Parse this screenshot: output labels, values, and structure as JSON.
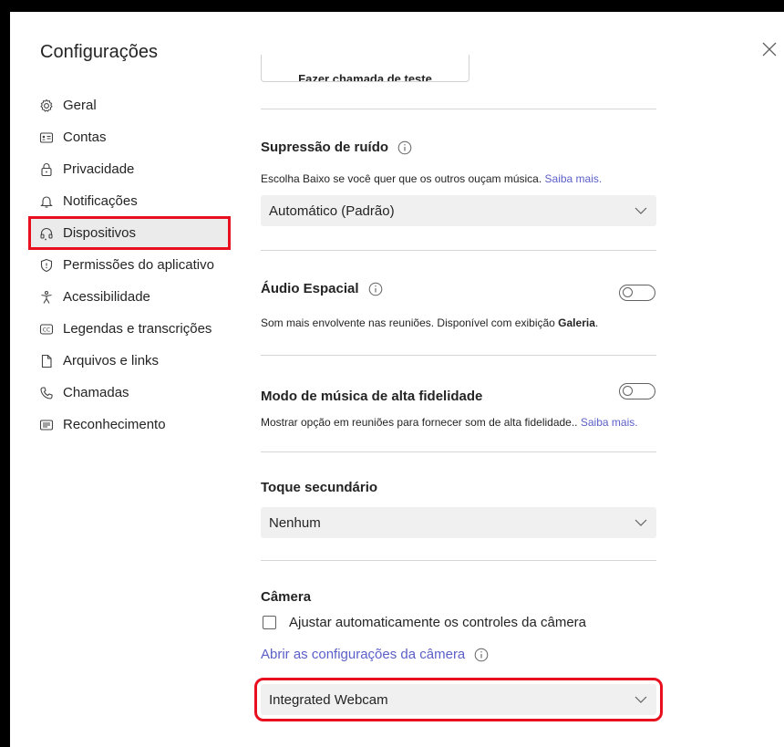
{
  "window": {
    "title": "Configurações"
  },
  "sidebar": {
    "items": [
      {
        "label": "Geral",
        "icon": "gear-icon"
      },
      {
        "label": "Contas",
        "icon": "account-card-icon"
      },
      {
        "label": "Privacidade",
        "icon": "lock-icon"
      },
      {
        "label": "Notificações",
        "icon": "bell-icon"
      },
      {
        "label": "Dispositivos",
        "icon": "headset-icon",
        "active": true
      },
      {
        "label": "Permissões do aplicativo",
        "icon": "shield-icon"
      },
      {
        "label": "Acessibilidade",
        "icon": "accessibility-icon"
      },
      {
        "label": "Legendas e transcrições",
        "icon": "cc-icon"
      },
      {
        "label": "Arquivos e links",
        "icon": "file-icon"
      },
      {
        "label": "Chamadas",
        "icon": "phone-icon"
      },
      {
        "label": "Reconhecimento",
        "icon": "recognition-icon"
      }
    ]
  },
  "main": {
    "test_call_label": "Fazer chamada de teste",
    "noise": {
      "title": "Supressão de ruído",
      "desc": "Escolha Baixo se você quer que os outros ouçam música.",
      "link": "Saiba mais.",
      "value": "Automático (Padrão)"
    },
    "spatial": {
      "title": "Áudio Espacial",
      "desc": "Som mais envolvente nas reuniões. Disponível com exibição",
      "desc_bold": "Galeria",
      "desc_end": ".",
      "enabled": false
    },
    "hifi": {
      "title": "Modo de música de alta fidelidade",
      "desc": "Mostrar opção em reuniões para fornecer som de alta fidelidade..",
      "link": "Saiba mais.",
      "enabled": false
    },
    "secondary_ring": {
      "title": "Toque secundário",
      "value": "Nenhum"
    },
    "camera": {
      "title": "Câmera",
      "checkbox_label": "Ajustar automaticamente os controles da câmera",
      "checked": false,
      "link": "Abrir as configurações da câmera",
      "value": "Integrated Webcam"
    }
  },
  "colors": {
    "accent_link": "#5b5fc7",
    "highlight_border": "#e8101e",
    "select_bg": "#f0f0f0"
  }
}
